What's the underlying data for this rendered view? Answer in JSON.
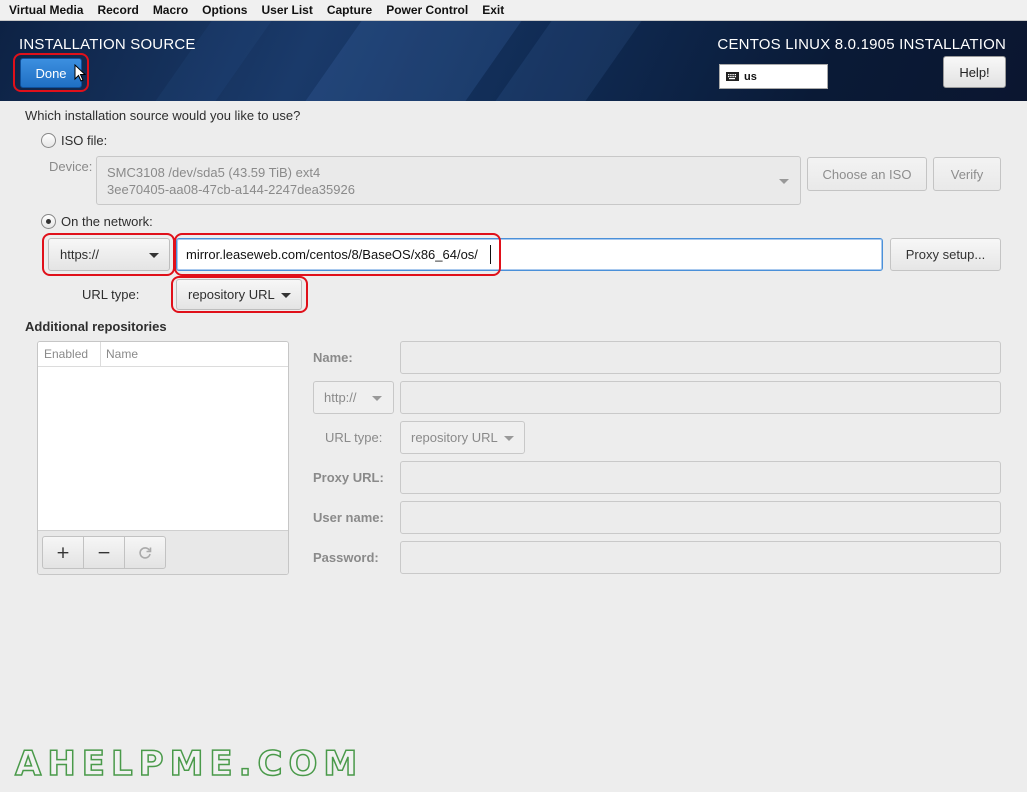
{
  "menubar": {
    "items": [
      "Virtual Media",
      "Record",
      "Macro",
      "Options",
      "User List",
      "Capture",
      "Power Control",
      "Exit"
    ]
  },
  "header": {
    "title": "INSTALLATION SOURCE",
    "product": "CENTOS LINUX 8.0.1905 INSTALLATION",
    "done_label": "Done",
    "keyboard_layout": "us",
    "help_label": "Help!"
  },
  "source": {
    "question": "Which installation source would you like to use?",
    "iso_label": "ISO file:",
    "iso_selected": false,
    "device_label": "Device:",
    "device_line1": "SMC3108 /dev/sda5 (43.59 TiB) ext4",
    "device_line2": "3ee70405-aa08-47cb-a144-2247dea35926",
    "choose_iso_label": "Choose an ISO",
    "verify_label": "Verify",
    "network_label": "On the network:",
    "network_selected": true,
    "protocol": "https://",
    "url": "mirror.leaseweb.com/centos/8/BaseOS/x86_64/os/",
    "proxy_label": "Proxy setup...",
    "url_type_label": "URL type:",
    "url_type": "repository URL"
  },
  "repos": {
    "heading": "Additional repositories",
    "columns": [
      "Enabled",
      "Name"
    ],
    "toolbar": {
      "add": "+",
      "remove": "−"
    },
    "name_label": "Name:",
    "protocol": "http://",
    "url_type_label": "URL type:",
    "url_type": "repository URL",
    "proxy_url_label": "Proxy URL:",
    "user_name_label": "User name:",
    "password_label": "Password:"
  },
  "watermark": "AHELPME.COM",
  "colors": {
    "highlight": "#e0101a",
    "done_button": "#2a7bd0",
    "header_bg": "#0f2a52"
  }
}
